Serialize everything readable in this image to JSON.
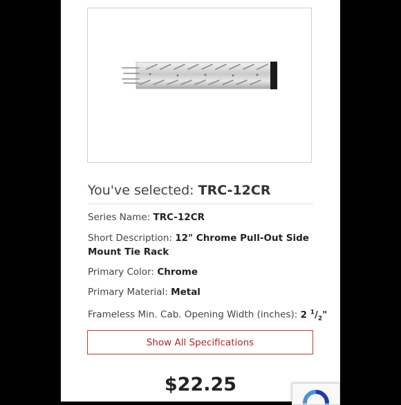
{
  "selection": {
    "prefix": "You've selected:",
    "sku": "TRC-12CR"
  },
  "specs": [
    {
      "label": "Series Name:",
      "value": "TRC-12CR"
    },
    {
      "label": "Short Description:",
      "value": "12\" Chrome Pull-Out Side Mount Tie Rack"
    },
    {
      "label": "Primary Color:",
      "value": "Chrome"
    },
    {
      "label": "Primary Material:",
      "value": "Metal"
    },
    {
      "label": "Frameless Min. Cab. Opening Width (inches):",
      "value_whole": "2",
      "value_num": "1",
      "value_den": "2",
      "value_suffix": "\""
    }
  ],
  "buttons": {
    "show_all": "Show All Specifications"
  },
  "price": "$22.25",
  "icons": {
    "product": "tie-rack-image",
    "recaptcha": "recaptcha-icon"
  },
  "colors": {
    "accent": "#b3261e",
    "background": "#000000"
  }
}
